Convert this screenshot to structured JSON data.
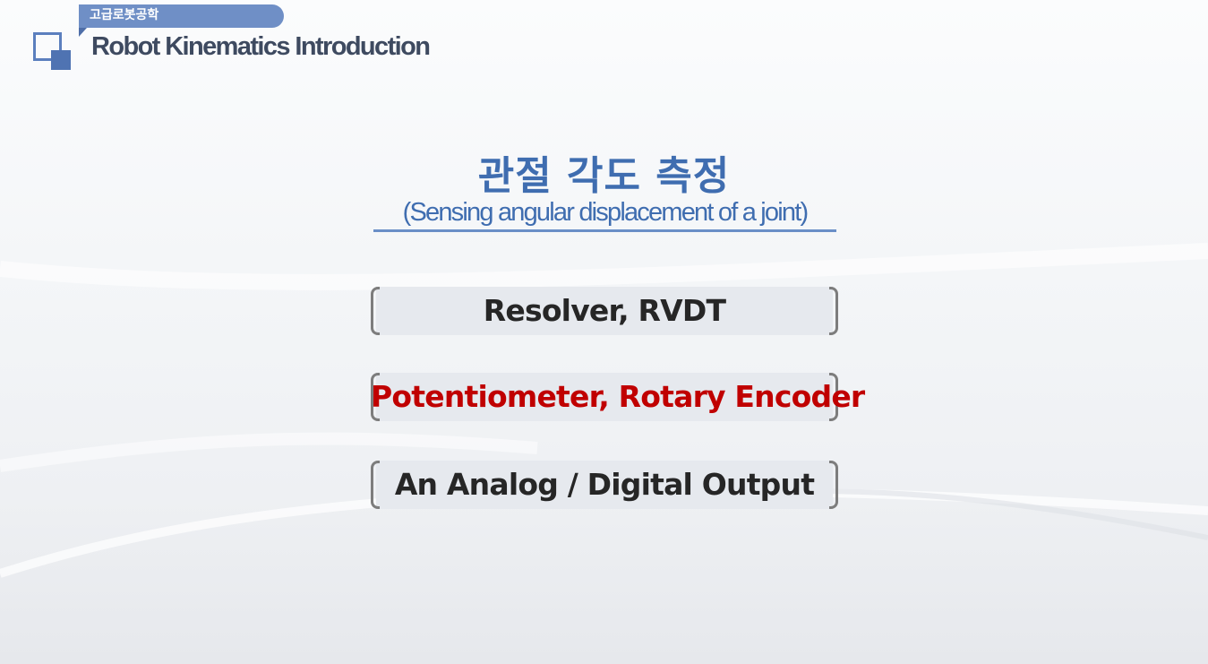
{
  "header": {
    "tag": "고급로봇공학",
    "title": "Robot Kinematics Introduction"
  },
  "slide": {
    "title": "관절 각도 측정",
    "subtitle": "(Sensing angular displacement of a joint)",
    "items": [
      {
        "label": "Resolver, RVDT",
        "highlighted": false
      },
      {
        "label": "Potentiometer, Rotary Encoder",
        "highlighted": true
      },
      {
        "label": "An Analog / Digital Output",
        "highlighted": false
      }
    ]
  },
  "colors": {
    "accent": "#3f6db0",
    "highlight": "#c00000",
    "tag": "#6f8fc6",
    "text": "#262626"
  }
}
